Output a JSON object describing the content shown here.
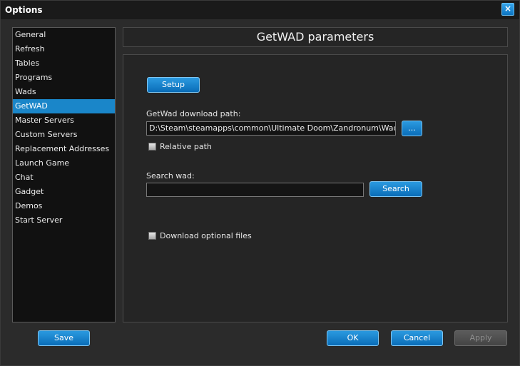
{
  "window": {
    "title": "Options",
    "close_glyph": "×"
  },
  "sidebar": {
    "items": [
      {
        "label": "General"
      },
      {
        "label": "Refresh"
      },
      {
        "label": "Tables"
      },
      {
        "label": "Programs"
      },
      {
        "label": "Wads"
      },
      {
        "label": "GetWAD",
        "selected": true
      },
      {
        "label": "Master Servers"
      },
      {
        "label": "Custom Servers"
      },
      {
        "label": "Replacement Addresses"
      },
      {
        "label": "Launch Game"
      },
      {
        "label": "Chat"
      },
      {
        "label": "Gadget"
      },
      {
        "label": "Demos"
      },
      {
        "label": "Start Server"
      }
    ]
  },
  "header": {
    "title": "GetWAD parameters"
  },
  "getwad": {
    "setup_label": "Setup",
    "download_path_label": "GetWad download path:",
    "download_path_value": "D:\\Steam\\steamapps\\common\\Ultimate Doom\\Zandronum\\Wads\\",
    "browse_label": "...",
    "relative_path_label": "Relative path",
    "relative_path_checked": false,
    "search_label": "Search wad:",
    "search_value": "",
    "search_button_label": "Search",
    "download_optional_label": "Download optional files",
    "download_optional_checked": false
  },
  "footer": {
    "save_label": "Save",
    "ok_label": "OK",
    "cancel_label": "Cancel",
    "apply_label": "Apply",
    "apply_enabled": false
  },
  "colors": {
    "accent": "#1a86c9",
    "window_bg": "#2b2b2b",
    "panel_bg": "#252525"
  }
}
